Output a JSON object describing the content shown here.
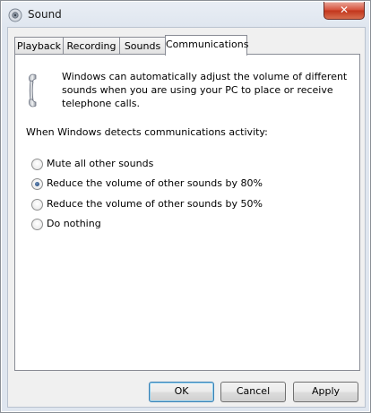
{
  "window": {
    "title": "Sound",
    "close_label": "✕"
  },
  "tabs": [
    {
      "label": "Playback"
    },
    {
      "label": "Recording"
    },
    {
      "label": "Sounds"
    },
    {
      "label": "Communications",
      "active": true
    }
  ],
  "communications": {
    "description": "Windows can automatically adjust the volume of different sounds when you are using your PC to place or receive telephone calls.",
    "prompt": "When Windows detects communications activity:",
    "options": [
      {
        "label": "Mute all other sounds",
        "selected": false
      },
      {
        "label": "Reduce the volume of other sounds by 80%",
        "selected": true
      },
      {
        "label": "Reduce the volume of other sounds by 50%",
        "selected": false
      },
      {
        "label": "Do nothing",
        "selected": false
      }
    ]
  },
  "buttons": {
    "ok": "OK",
    "cancel": "Cancel",
    "apply": "Apply"
  },
  "colors": {
    "close_button": "#c7381e",
    "default_button_border": "#3c7fb1",
    "tab_border": "#898c95"
  }
}
